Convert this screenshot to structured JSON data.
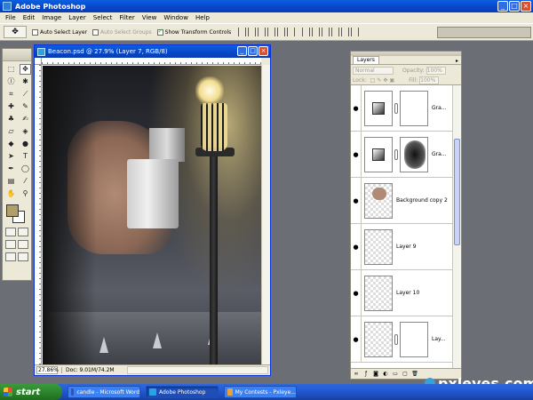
{
  "app": {
    "title": "Adobe Photoshop"
  },
  "window_controls": {
    "minimize": "_",
    "maximize": "□",
    "close": "×"
  },
  "menu": [
    "File",
    "Edit",
    "Image",
    "Layer",
    "Select",
    "Filter",
    "View",
    "Window",
    "Help"
  ],
  "options": {
    "auto_select_layer": "Auto Select Layer",
    "auto_select_groups": "Auto Select Groups",
    "show_transform_controls": "Show Transform Controls",
    "auto_select_layer_checked": false,
    "show_transform_controls_checked": true
  },
  "document": {
    "title": "Beacon.psd @ 27.9% (Layer 7, RGB/8)",
    "zoom": "27.86%",
    "doc_info": "Doc: 9.01M/74.2M"
  },
  "toolbox": {
    "foreground_color": "#b19f6a",
    "background_color": "#ffffff"
  },
  "layers_panel": {
    "tab": "Layers",
    "blend_mode": "Normal",
    "opacity_label": "Opacity:",
    "opacity_value": "100%",
    "lock_label": "Lock:",
    "fill_label": "Fill:",
    "fill_value": "100%",
    "layers": [
      {
        "name": "Gra...",
        "type": "adjustment",
        "mask": "white"
      },
      {
        "name": "Gra...",
        "type": "adjustment",
        "mask": "dark"
      },
      {
        "name": "Background copy 2",
        "type": "pixel",
        "mask": null
      },
      {
        "name": "Layer 9",
        "type": "pixel",
        "mask": null
      },
      {
        "name": "Layer 10",
        "type": "pixel",
        "mask": null
      },
      {
        "name": "Lay...",
        "type": "pixel",
        "mask": "white"
      }
    ]
  },
  "taskbar": {
    "start_label": "start",
    "tasks": [
      {
        "label": "candle - Microsoft Word",
        "active": false
      },
      {
        "label": "Adobe Photoshop",
        "active": true
      },
      {
        "label": "My Contests - Pxleye...",
        "active": false
      }
    ]
  },
  "watermark": "pxleyes.com"
}
